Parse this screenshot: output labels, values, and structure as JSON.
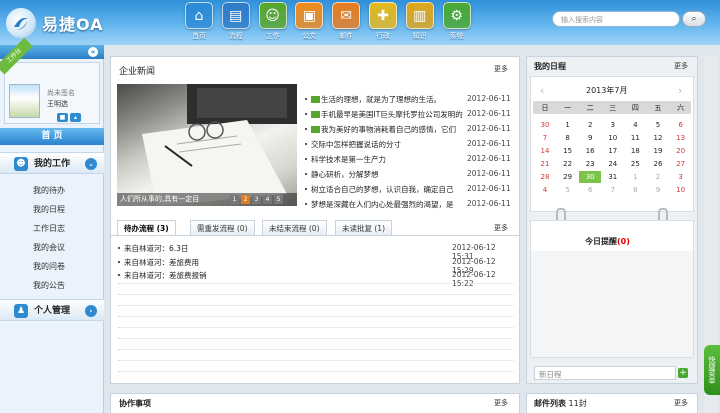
{
  "header": {
    "brand": "易捷OA",
    "nav": [
      {
        "label": "首页",
        "icon": "home-icon",
        "color": "#2e8bd6",
        "glyph": "⌂"
      },
      {
        "label": "流程",
        "icon": "notebook-icon",
        "color": "#2f7cc9",
        "glyph": "▤"
      },
      {
        "label": "工作",
        "icon": "people-icon",
        "color": "#5aa62c",
        "glyph": "☺"
      },
      {
        "label": "公文",
        "icon": "briefcase-icon",
        "color": "#ef8a1c",
        "glyph": "▣"
      },
      {
        "label": "邮件",
        "icon": "mail-icon",
        "color": "#e97d1e",
        "glyph": "✉"
      },
      {
        "label": "行政",
        "icon": "puzzle-icon",
        "color": "#e5b81b",
        "glyph": "✚"
      },
      {
        "label": "知识",
        "icon": "books-icon",
        "color": "#e0a61a",
        "glyph": "▥"
      },
      {
        "label": "系统",
        "icon": "gear-icon",
        "color": "#4aa832",
        "glyph": "⚙"
      }
    ],
    "search_placeholder": "输入搜索内容"
  },
  "sidebar": {
    "ribbon": "工作台",
    "signature": "尚未签名",
    "user": "王明选",
    "home": "首 页",
    "sections": [
      {
        "label": "我的工作",
        "items": [
          "我的待办",
          "我的日程",
          "工作日志",
          "我的会议",
          "我的问卷",
          "我的公告"
        ]
      },
      {
        "label": "个人管理",
        "items": []
      }
    ]
  },
  "news": {
    "title": "企业新闻",
    "more": "更多",
    "caption": "人们所从事的,具有一定目",
    "pages": [
      "1",
      "2",
      "3",
      "4",
      "5"
    ],
    "items": [
      {
        "text": "生活的理想，就是为了理想的生活。",
        "date": "2012-06-11",
        "new": true
      },
      {
        "text": "手机最早是美国IT巨头摩托罗拉公司发明的",
        "date": "2012-06-11",
        "new": true
      },
      {
        "text": "我为美好的事物消耗着自己的感情，它们",
        "date": "2012-06-11",
        "new": true
      },
      {
        "text": "交际中怎样把握说话的分寸",
        "date": "2012-06-11",
        "new": false
      },
      {
        "text": "科学技术是第一生产力",
        "date": "2012-06-11",
        "new": false
      },
      {
        "text": "静心研析，分解梦想",
        "date": "2012-06-11",
        "new": false
      },
      {
        "text": "树立适合自己的梦想，认识自我，确定自己",
        "date": "2012-06-11",
        "new": false
      },
      {
        "text": "梦想是深藏在人们内心处最强烈的渴望，是",
        "date": "2012-06-11",
        "new": false
      }
    ]
  },
  "flow": {
    "tabs": [
      "待办流程 (3)",
      "需重发流程 (0)",
      "未结束流程 (0)",
      "未读批复 (1)"
    ],
    "more": "更多",
    "items": [
      {
        "text": "来自林道河：6.3日",
        "date": "2012-06-12 15:31"
      },
      {
        "text": "来自林道河：差旅费用",
        "date": "2012-06-12 15:29"
      },
      {
        "text": "来自林道河：差旅费报销",
        "date": "2012-06-12 15:22"
      }
    ]
  },
  "collab": {
    "title": "协作事项",
    "more": "更多"
  },
  "schedule": {
    "title": "我的日程",
    "more": "更多",
    "month": "2013年7月",
    "weekdays": [
      "日",
      "一",
      "二",
      "三",
      "四",
      "五",
      "六"
    ],
    "weeks": [
      [
        "30",
        "1",
        "2",
        "3",
        "4",
        "5",
        "6"
      ],
      [
        "7",
        "8",
        "9",
        "10",
        "11",
        "12",
        "13"
      ],
      [
        "14",
        "15",
        "16",
        "17",
        "18",
        "19",
        "20"
      ],
      [
        "21",
        "22",
        "23",
        "24",
        "25",
        "26",
        "27"
      ],
      [
        "28",
        "29",
        "30",
        "31",
        "1",
        "2",
        "3"
      ],
      [
        "4",
        "5",
        "6",
        "7",
        "8",
        "9",
        "10"
      ]
    ],
    "today": "30",
    "reminder_title": "今日提醒",
    "reminder_count": "(0)",
    "new_placeholder": "新日程"
  },
  "mail": {
    "title": "邮件列表",
    "count": "11封",
    "more": "更多"
  },
  "side_tab": "快捷菜单"
}
